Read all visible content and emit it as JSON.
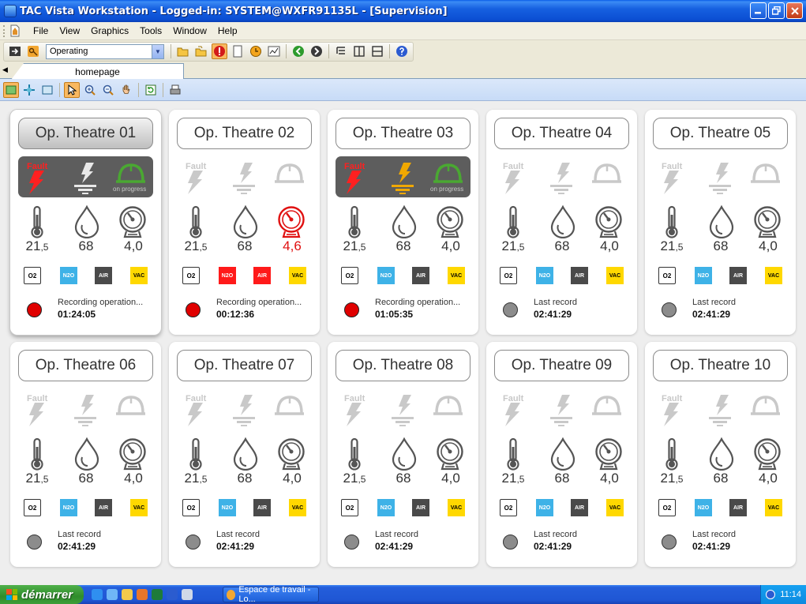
{
  "window": {
    "title": "TAC Vista Workstation - Logged-in: SYSTEM@WXFR91135L - [Supervision]"
  },
  "menu": [
    "File",
    "View",
    "Graphics",
    "Tools",
    "Window",
    "Help"
  ],
  "toolbar": {
    "mode": "Operating"
  },
  "tab": {
    "label": "homepage"
  },
  "labels": {
    "fault": "Fault",
    "on_progress": "on progress",
    "o2": "O2",
    "n2o": "N2O",
    "air": "AIR",
    "vac": "VAC"
  },
  "colors": {
    "fault_red": "#ff2020",
    "earth_orange": "#f0a800",
    "helmet_green": "#4aa832",
    "inactive_grey": "#c9c9c9",
    "n2o_blue": "#3eb2e7",
    "vac_yellow": "#ffd800",
    "alarm_red": "#ff1a1a"
  },
  "theatres": [
    {
      "name": "Op. Theatre 01",
      "fault": true,
      "earth_alarm": false,
      "in_progress": true,
      "temp_int": "21",
      "temp_dec": ",5",
      "humidity": "68",
      "pressure": "4,0",
      "pressure_alarm": false,
      "n2o_alarm": false,
      "air_alarm": false,
      "recording": true,
      "rec_label": "Recording operation...",
      "rec_time": "01:24:05"
    },
    {
      "name": "Op. Theatre 02",
      "fault": false,
      "earth_alarm": false,
      "in_progress": false,
      "temp_int": "21",
      "temp_dec": ",5",
      "humidity": "68",
      "pressure": "4,6",
      "pressure_alarm": true,
      "n2o_alarm": true,
      "air_alarm": true,
      "recording": true,
      "rec_label": "Recording operation...",
      "rec_time": "00:12:36"
    },
    {
      "name": "Op. Theatre 03",
      "fault": true,
      "earth_alarm": true,
      "in_progress": true,
      "temp_int": "21",
      "temp_dec": ",5",
      "humidity": "68",
      "pressure": "4,0",
      "pressure_alarm": false,
      "n2o_alarm": false,
      "air_alarm": false,
      "recording": true,
      "rec_label": "Recording operation...",
      "rec_time": "01:05:35"
    },
    {
      "name": "Op. Theatre 04",
      "fault": false,
      "earth_alarm": false,
      "in_progress": false,
      "temp_int": "21",
      "temp_dec": ",5",
      "humidity": "68",
      "pressure": "4,0",
      "pressure_alarm": false,
      "n2o_alarm": false,
      "air_alarm": false,
      "recording": false,
      "rec_label": "Last record",
      "rec_time": "02:41:29"
    },
    {
      "name": "Op. Theatre 05",
      "fault": false,
      "earth_alarm": false,
      "in_progress": false,
      "temp_int": "21",
      "temp_dec": ",5",
      "humidity": "68",
      "pressure": "4,0",
      "pressure_alarm": false,
      "n2o_alarm": false,
      "air_alarm": false,
      "recording": false,
      "rec_label": "Last record",
      "rec_time": "02:41:29"
    },
    {
      "name": "Op. Theatre 06",
      "fault": false,
      "earth_alarm": false,
      "in_progress": false,
      "temp_int": "21",
      "temp_dec": ",5",
      "humidity": "68",
      "pressure": "4,0",
      "pressure_alarm": false,
      "n2o_alarm": false,
      "air_alarm": false,
      "recording": false,
      "rec_label": "Last record",
      "rec_time": "02:41:29"
    },
    {
      "name": "Op. Theatre 07",
      "fault": false,
      "earth_alarm": false,
      "in_progress": false,
      "temp_int": "21",
      "temp_dec": ",5",
      "humidity": "68",
      "pressure": "4,0",
      "pressure_alarm": false,
      "n2o_alarm": false,
      "air_alarm": false,
      "recording": false,
      "rec_label": "Last record",
      "rec_time": "02:41:29"
    },
    {
      "name": "Op. Theatre 08",
      "fault": false,
      "earth_alarm": false,
      "in_progress": false,
      "temp_int": "21",
      "temp_dec": ",5",
      "humidity": "68",
      "pressure": "4,0",
      "pressure_alarm": false,
      "n2o_alarm": false,
      "air_alarm": false,
      "recording": false,
      "rec_label": "Last record",
      "rec_time": "02:41:29"
    },
    {
      "name": "Op. Theatre 09",
      "fault": false,
      "earth_alarm": false,
      "in_progress": false,
      "temp_int": "21",
      "temp_dec": ",5",
      "humidity": "68",
      "pressure": "4,0",
      "pressure_alarm": false,
      "n2o_alarm": false,
      "air_alarm": false,
      "recording": false,
      "rec_label": "Last record",
      "rec_time": "02:41:29"
    },
    {
      "name": "Op. Theatre 10",
      "fault": false,
      "earth_alarm": false,
      "in_progress": false,
      "temp_int": "21",
      "temp_dec": ",5",
      "humidity": "68",
      "pressure": "4,0",
      "pressure_alarm": false,
      "n2o_alarm": false,
      "air_alarm": false,
      "recording": false,
      "rec_label": "Last record",
      "rec_time": "02:41:29"
    }
  ],
  "taskbar": {
    "start": "démarrer",
    "task": "Espace de travail - Lo...",
    "clock": "11:14"
  }
}
